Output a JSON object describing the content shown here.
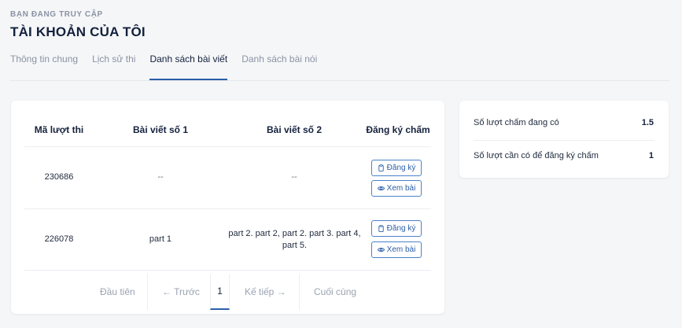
{
  "header": {
    "eyebrow": "BẠN ĐANG TRUY CẬP",
    "title": "TÀI KHOẢN CỦA TÔI"
  },
  "tabs": [
    {
      "label": "Thông tin chung"
    },
    {
      "label": "Lịch sử thi"
    },
    {
      "label": "Danh sách bài viết",
      "active": true
    },
    {
      "label": "Danh sách bài nói"
    }
  ],
  "table": {
    "columns": [
      "Mã lượt thi",
      "Bài viết số 1",
      "Bài viết số 2",
      "Đăng ký chấm"
    ],
    "rows": [
      {
        "id": "230686",
        "essay1": "--",
        "essay2": "--",
        "register_label": "Đăng ký",
        "view_label": "Xem bài"
      },
      {
        "id": "226078",
        "essay1": "part 1",
        "essay2": "part 2. part 2, part 2. part 3. part 4, part 5.",
        "register_label": "Đăng ký",
        "view_label": "Xem bài"
      }
    ]
  },
  "pagination": {
    "first": "Đầu tiên",
    "prev": "← Trước",
    "current": "1",
    "next": "Kế tiếp →",
    "last": "Cuối cùng"
  },
  "summary": {
    "available_label": "Số lượt chấm đang có",
    "available_value": "1.5",
    "required_label": "Số lượt cần có để đăng ký chấm",
    "required_value": "1"
  },
  "colors": {
    "accent": "#2b5fa8",
    "background": "#f5f6f8"
  }
}
